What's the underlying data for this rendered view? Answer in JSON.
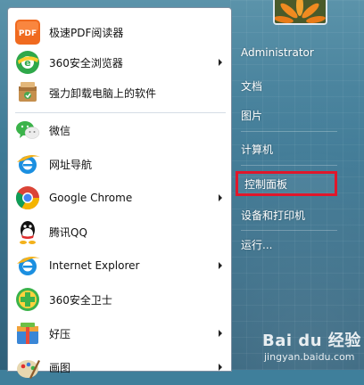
{
  "programs": [
    {
      "label": "极速PDF阅读器",
      "icon": "pdf-reader-icon",
      "has_submenu": false
    },
    {
      "label": "360安全浏览器",
      "icon": "360-browser-icon",
      "has_submenu": true
    },
    {
      "label": "强力卸载电脑上的软件",
      "icon": "uninstaller-icon",
      "has_submenu": false
    },
    {
      "label": "微信",
      "icon": "wechat-icon",
      "has_submenu": false
    },
    {
      "label": "网址导航",
      "icon": "ie-nav-icon",
      "has_submenu": false
    },
    {
      "label": "Google Chrome",
      "icon": "chrome-icon",
      "has_submenu": true
    },
    {
      "label": "腾讯QQ",
      "icon": "qq-icon",
      "has_submenu": false
    },
    {
      "label": "Internet Explorer",
      "icon": "ie-icon",
      "has_submenu": true
    },
    {
      "label": "360安全卫士",
      "icon": "360-safe-icon",
      "has_submenu": false
    },
    {
      "label": "好压",
      "icon": "haozip-icon",
      "has_submenu": true
    },
    {
      "label": "画图",
      "icon": "paint-icon",
      "has_submenu": true
    }
  ],
  "right_menu": {
    "user": "Administrator",
    "items": [
      "文档",
      "图片",
      "计算机",
      "控制面板",
      "设备和打印机",
      "运行..."
    ],
    "highlighted": "控制面板"
  },
  "watermark": {
    "logo_text": "Bai du 经验",
    "url": "jingyan.baidu.com"
  },
  "colors": {
    "highlight_border": "#e0172b",
    "right_panel_bg": "#3f7f9b"
  }
}
